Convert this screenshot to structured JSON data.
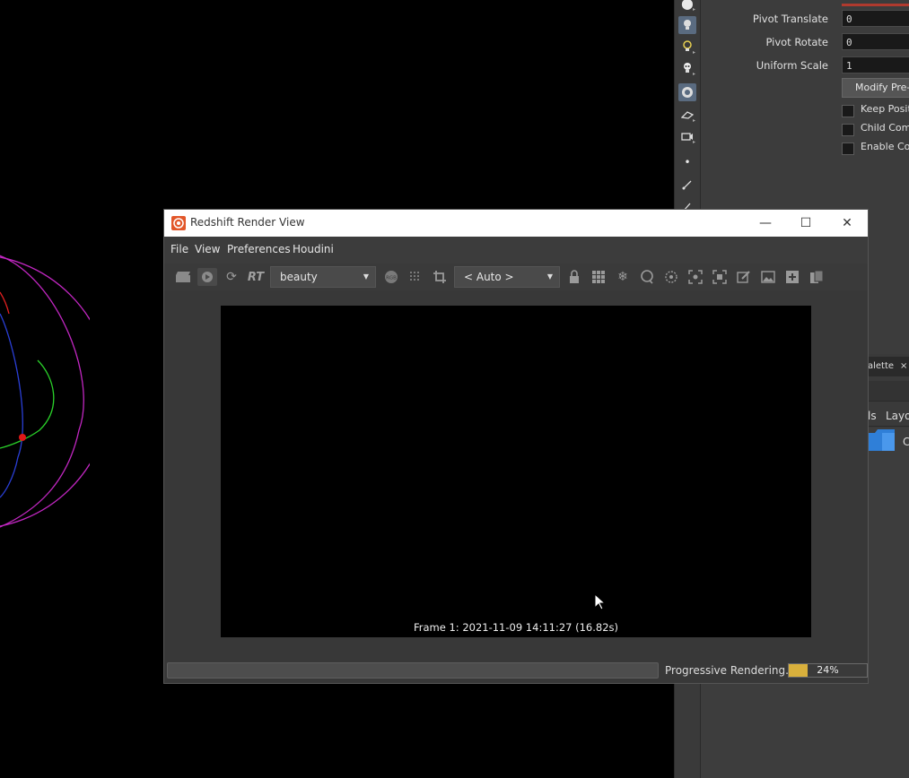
{
  "parameters": {
    "pivot_translate": {
      "label": "Pivot Translate",
      "value": "0"
    },
    "pivot_rotate": {
      "label": "Pivot Rotate",
      "value": "0"
    },
    "uniform_scale": {
      "label": "Uniform Scale",
      "value": "1"
    },
    "modify_button": "Modify Pre-T",
    "checks": [
      {
        "label": "Keep Positi"
      },
      {
        "label": "Child Comp"
      },
      {
        "label": "Enable Con"
      }
    ]
  },
  "lower_pane": {
    "palette_tab": "alette",
    "palette_close": "×",
    "tabs": [
      "ls",
      "Layo"
    ],
    "folder_label": "C"
  },
  "render_view": {
    "title": "Redshift Render View",
    "window_controls": {
      "minimize": "—",
      "maximize": "☐",
      "close": "✕"
    },
    "menu": [
      "File",
      "View",
      "Preferences",
      "Houdini"
    ],
    "toolbar": {
      "rt_label": "RT",
      "aov_combo": "beauty",
      "camera_combo": "< Auto >"
    },
    "frame_info": "Frame  1:  2021-11-09  14:11:27  (16.82s)",
    "status": {
      "text": "Progressive Rendering...",
      "percent_label": "24%",
      "percent": 24,
      "fill_color": "#d9b03c"
    }
  },
  "icons": {
    "side_toolbar": [
      "light-icon",
      "light-bulb-icon",
      "spot-light-icon",
      "skull-light-icon",
      "env-light-icon",
      "camera-icon",
      "camera-switch-icon",
      "dot-icon",
      "curve-icon",
      "pen-icon"
    ],
    "render_toolbar": [
      "clapper-icon",
      "play-icon",
      "refresh-icon",
      "rgb-icon",
      "grid-icon",
      "crop-icon",
      "lock-icon",
      "tiles-icon",
      "snowflake-icon",
      "lasso-icon",
      "focus-icon",
      "fit-icon",
      "expand-icon",
      "edit-icon",
      "image-icon",
      "add-snapshot-icon",
      "copy-icon"
    ]
  },
  "colors": {
    "accent_red": "#b03a2e",
    "progress_yellow": "#d9b03c",
    "window_bg": "#383838"
  }
}
